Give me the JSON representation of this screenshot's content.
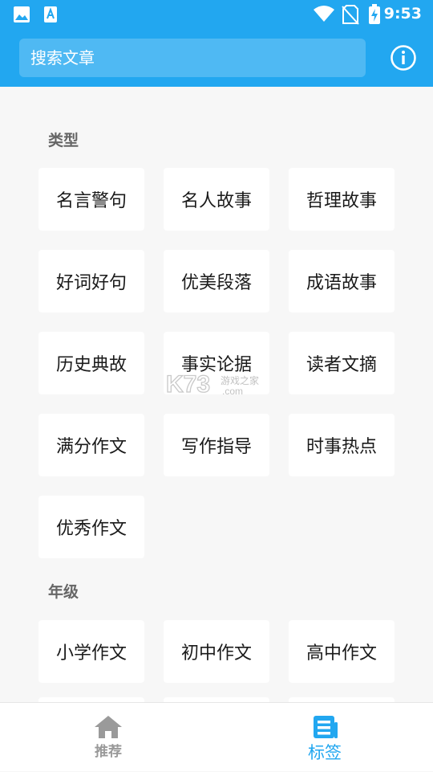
{
  "colors": {
    "accent": "#22a7f0",
    "search_bg": "#4fb9f3",
    "page_bg": "#f7f7f7",
    "inactive": "#999999"
  },
  "status_bar": {
    "time": "9:53",
    "icons": [
      "image-notification-icon",
      "text-notification-icon",
      "wifi-icon",
      "no-sim-icon",
      "battery-charging-icon"
    ]
  },
  "search": {
    "placeholder": "搜索文章"
  },
  "sections": [
    {
      "title": "类型",
      "tags": [
        "名言警句",
        "名人故事",
        "哲理故事",
        "好词好句",
        "优美段落",
        "成语故事",
        "历史典故",
        "事实论据",
        "读者文摘",
        "满分作文",
        "写作指导",
        "时事热点",
        "优秀作文"
      ]
    },
    {
      "title": "年级",
      "tags": [
        "小学作文",
        "初中作文",
        "高中作文"
      ]
    }
  ],
  "watermark": {
    "brand": "K73",
    "cn": "游戏之家",
    "domain": ".com"
  },
  "bottom_nav": [
    {
      "label": "推荐",
      "icon": "home-icon",
      "active": false
    },
    {
      "label": "标签",
      "icon": "article-list-icon",
      "active": true
    }
  ]
}
